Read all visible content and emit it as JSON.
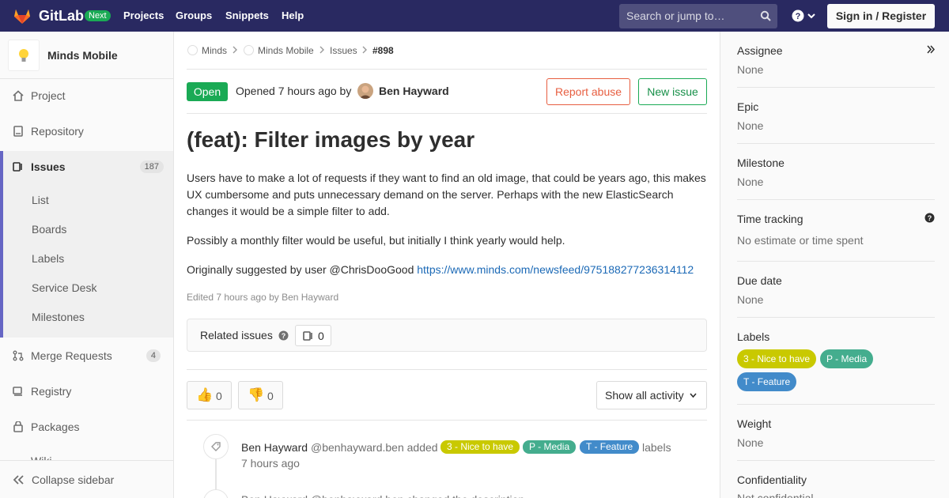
{
  "navbar": {
    "brand": "GitLab",
    "badge": "Next",
    "links": [
      "Projects",
      "Groups",
      "Snippets",
      "Help"
    ],
    "search_placeholder": "Search or jump to…",
    "signin_label": "Sign in / Register"
  },
  "sidebar": {
    "project_name": "Minds Mobile",
    "items": [
      {
        "label": "Project",
        "icon": "home-icon"
      },
      {
        "label": "Repository",
        "icon": "doc-icon"
      },
      {
        "label": "Issues",
        "icon": "issues-icon",
        "count": "187"
      },
      {
        "label": "Merge Requests",
        "icon": "merge-request-icon",
        "count": "4"
      },
      {
        "label": "Registry",
        "icon": "container-icon"
      },
      {
        "label": "Packages",
        "icon": "package-icon"
      }
    ],
    "issue_subitems": [
      "List",
      "Boards",
      "Labels",
      "Service Desk",
      "Milestones"
    ],
    "wiki_peek": "Wiki",
    "collapse_label": "Collapse sidebar"
  },
  "breadcrumb": {
    "items": [
      "Minds",
      "Minds Mobile",
      "Issues",
      "#898"
    ]
  },
  "issue": {
    "status": "Open",
    "opened_text": "Opened 7 hours ago by",
    "author": "Ben Hayward",
    "report_abuse": "Report abuse",
    "new_issue": "New issue",
    "title": "(feat): Filter images by year",
    "paragraphs": [
      "Users have to make a lot of requests if they want to find an old image, that could be years ago, this makes UX cumbersome and puts unnecessary demand on the server. Perhaps with the new ElasticSearch changes it would be a simple filter to add.",
      "Possibly a monthly filter would be useful, but initially I think yearly would help."
    ],
    "suggested_prefix": "Originally suggested by user @ChrisDooGood",
    "suggested_link": "https://www.minds.com/newsfeed/975188277236314112",
    "edited": "Edited 7 hours ago by Ben Hayward",
    "related_label": "Related issues",
    "related_count": "0",
    "thumbs_up": "0",
    "thumbs_down": "0",
    "activity_filter": "Show all activity"
  },
  "activity": {
    "author": "Ben Hayward",
    "handle_action": "@benhayward.ben added",
    "labels": [
      {
        "text": "3 - Nice to have",
        "color": "#c9c900"
      },
      {
        "text": "P - Media",
        "color": "#44ad8e"
      },
      {
        "text": "T - Feature",
        "color": "#428bca"
      }
    ],
    "labels_word": "labels",
    "time": "7 hours ago",
    "next_peek": "Ben Hayward @benhayward.ben changed the description"
  },
  "right_sidebar": {
    "assignee_title": "Assignee",
    "assignee_value": "None",
    "epic_title": "Epic",
    "epic_value": "None",
    "milestone_title": "Milestone",
    "milestone_value": "None",
    "time_title": "Time tracking",
    "time_value": "No estimate or time spent",
    "due_title": "Due date",
    "due_value": "None",
    "labels_title": "Labels",
    "labels": [
      {
        "text": "3 - Nice to have",
        "color": "#c9c900"
      },
      {
        "text": "P - Media",
        "color": "#44ad8e"
      },
      {
        "text": "T - Feature",
        "color": "#428bca"
      }
    ],
    "weight_title": "Weight",
    "weight_value": "None",
    "confidentiality_title": "Confidentiality",
    "confidentiality_value": "Not confidential"
  }
}
